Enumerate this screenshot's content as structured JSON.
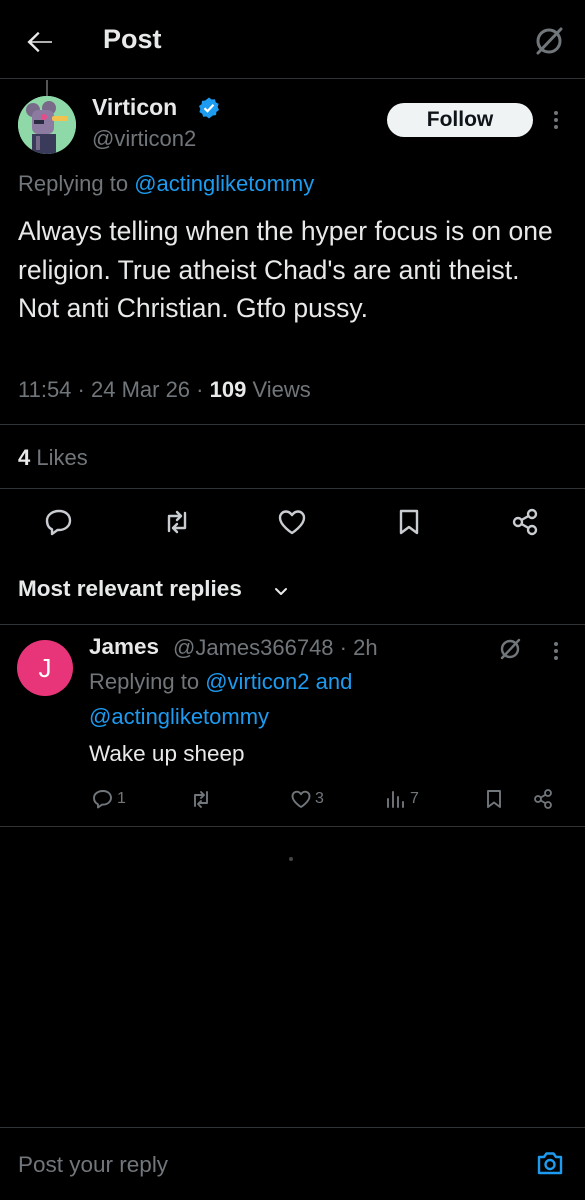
{
  "header": {
    "title": "Post"
  },
  "post": {
    "author_name": "Virticon",
    "author_handle": "@virticon2",
    "follow_label": "Follow",
    "replying_prefix": "Replying to",
    "replying_handle": "@actingliketommy",
    "text": "Always telling when the hyper focus is on one religion. True atheist Chad's are anti theist. Not anti Christian. Gtfo pussy.",
    "time": "11:54",
    "date": "24 Mar 26",
    "views_count": "109",
    "views_label": "Views",
    "likes_count": "4",
    "likes_label": "Likes"
  },
  "replies_sort": {
    "label": "Most relevant replies"
  },
  "reply": {
    "avatar_letter": "J",
    "name": "James",
    "handle": "@James366748",
    "age": "2h",
    "replying_prefix": "Replying to",
    "mention1": "@virticon2",
    "and_word": "and",
    "mention2": "@actingliketommy",
    "text": "Wake up sheep",
    "reply_count": "1",
    "like_count": "3",
    "view_count": "7"
  },
  "composer": {
    "placeholder": "Post your reply"
  },
  "colors": {
    "background": "#000000",
    "accent": "#1d9bf0",
    "muted": "#71767b",
    "avatar_reply": "#e8357a"
  }
}
